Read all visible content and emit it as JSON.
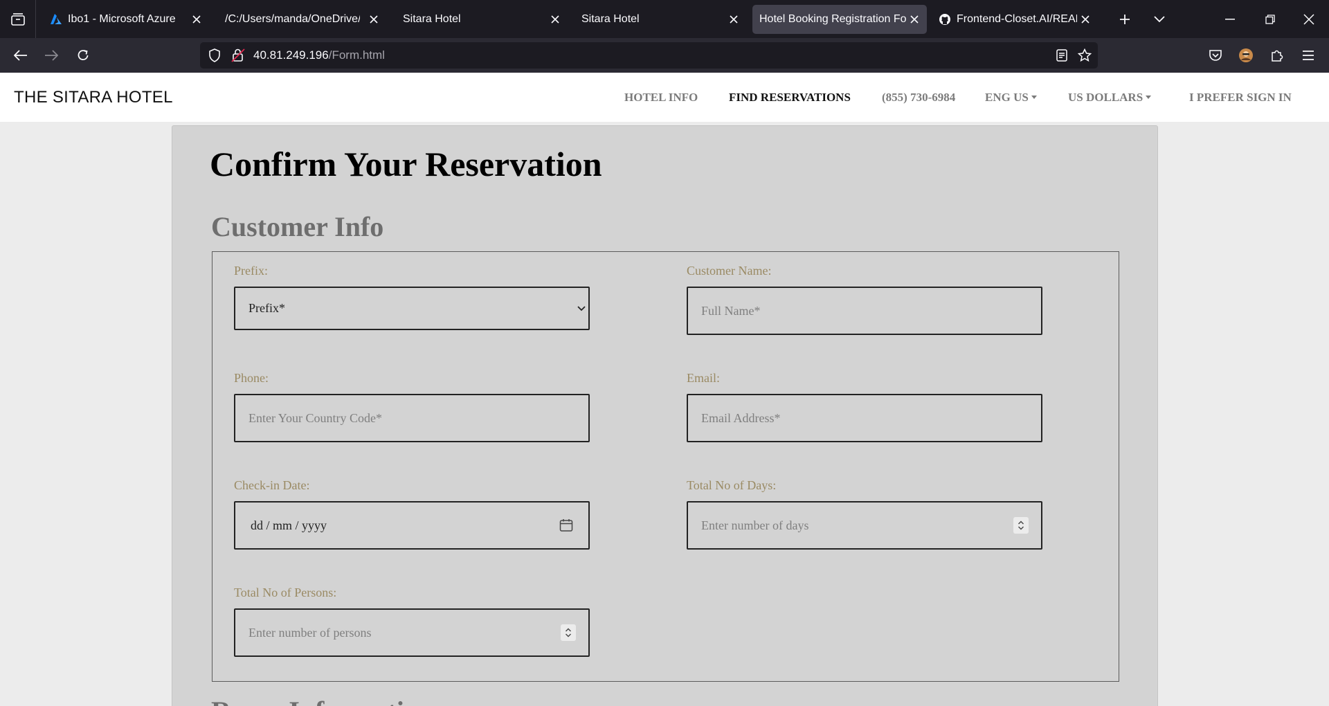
{
  "browser": {
    "tabs": [
      {
        "title": "Ibo1 - Microsoft Azure",
        "icon": "azure-icon",
        "active": false
      },
      {
        "title": "/C:/Users/manda/OneDrive/Desktop",
        "icon": "",
        "active": false
      },
      {
        "title": "Sitara Hotel",
        "icon": "",
        "active": false
      },
      {
        "title": "Sitara Hotel",
        "icon": "",
        "active": false
      },
      {
        "title": "Hotel Booking Registration Form",
        "icon": "",
        "active": true
      },
      {
        "title": "Frontend-Closet.AI/README.md",
        "icon": "github-icon",
        "active": false
      }
    ],
    "url": {
      "host": "40.81.249.196",
      "path": "/Form.html"
    }
  },
  "site": {
    "brand": "THE SITARA HOTEL",
    "nav": {
      "hotel_info": "HOTEL INFO",
      "find_reservations": "FIND RESERVATIONS",
      "phone": "(855) 730-6984",
      "language": "ENG US",
      "currency": "US DOLLARS",
      "sign_in": "I PREFER SIGN IN"
    }
  },
  "form": {
    "title": "Confirm Your Reservation",
    "section_customer": "Customer Info",
    "section_next": "Room Information",
    "prefix": {
      "label": "Prefix:",
      "selected": "Prefix*"
    },
    "name": {
      "label": "Customer Name:",
      "placeholder": "Full Name*"
    },
    "phone": {
      "label": "Phone:",
      "placeholder": "Enter Your Country Code*"
    },
    "email": {
      "label": "Email:",
      "placeholder": "Email Address*"
    },
    "checkin": {
      "label": "Check-in Date:",
      "value": "dd / mm / yyyy"
    },
    "days": {
      "label": "Total No of Days:",
      "placeholder": "Enter number of days"
    },
    "persons": {
      "label": "Total No of Persons:",
      "placeholder": "Enter number of persons"
    }
  },
  "colors": {
    "label": "#9a8a63",
    "card": "#d3d3d3",
    "chrome": "#1c1b22"
  }
}
